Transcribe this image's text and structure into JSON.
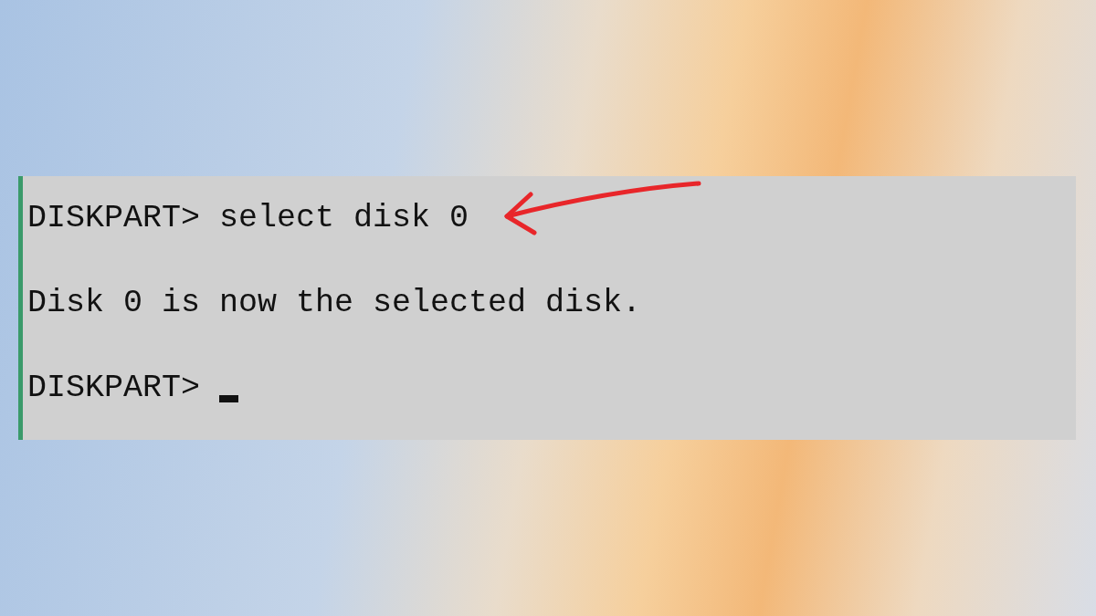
{
  "console": {
    "lines": [
      {
        "kind": "command",
        "prompt": "DISKPART>",
        "command": "select disk 0"
      },
      {
        "kind": "output",
        "text": "Disk 0 is now the selected disk."
      },
      {
        "kind": "prompt",
        "prompt": "DISKPART>",
        "cursor": true
      }
    ]
  }
}
